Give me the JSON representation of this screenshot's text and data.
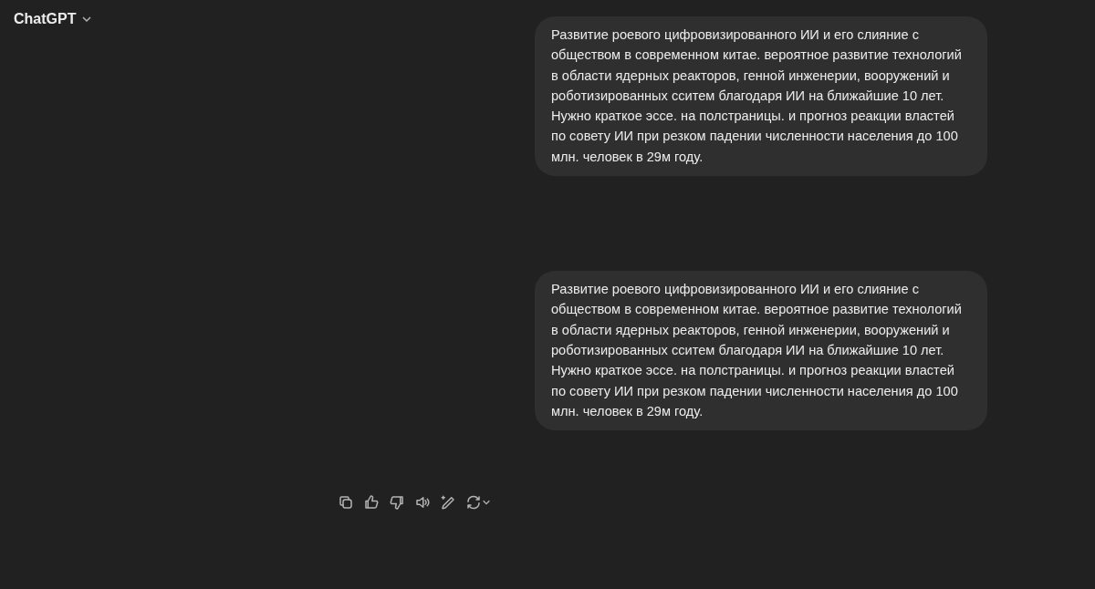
{
  "header": {
    "title": "ChatGPT"
  },
  "messages": [
    {
      "kind": "user",
      "text": "Развитие роевого цифровизированного ИИ и его слияние с обществом в современном китае. вероятное развитие технологий в области ядерных реакторов, генной инженерии, вооружений и роботизированных сситем благодаря ИИ на ближайшие 10 лет. Нужно краткое эссе. на полстраницы. и прогноз реакции властей по совету ИИ при резком падении численности населения до 100 млн. человек в 29м году."
    },
    {
      "kind": "user",
      "text": "Развитие роевого цифровизированного ИИ и его слияние с обществом в современном китае. вероятное развитие технологий в области ядерных реакторов, генной инженерии, вооружений и роботизированных сситем благодаря ИИ на ближайшие 10 лет. Нужно краткое эссе. на полстраницы. и прогноз реакции властей по совету ИИ при резком падении численности населения до 100 млн. человек в 29м году."
    }
  ]
}
